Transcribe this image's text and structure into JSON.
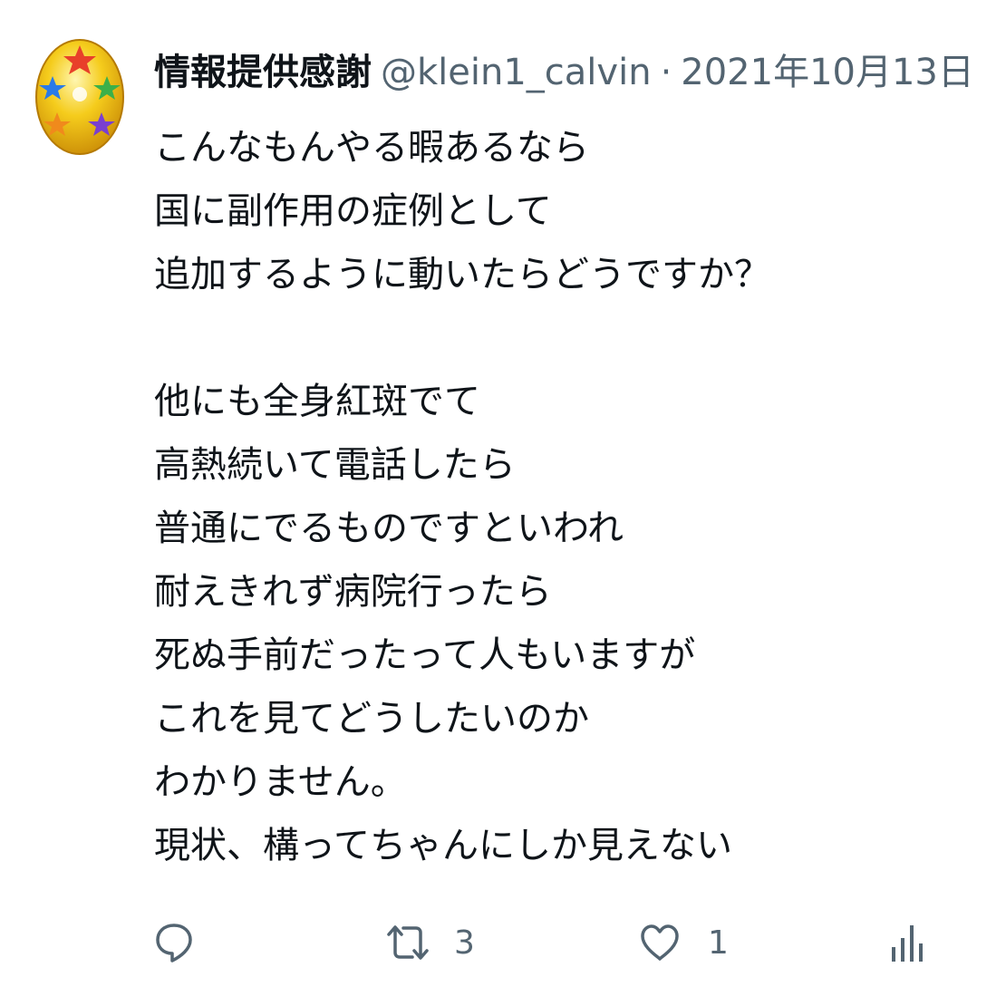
{
  "author": {
    "display_name": "情報提供感謝",
    "handle": "@klein1_calvin",
    "separator": "·",
    "date": "2021年10月13日",
    "avatar_icon": "star-egg-avatar"
  },
  "tweet": {
    "lines": [
      "こんなもんやる暇あるなら",
      "国に副作用の症例として",
      "追加するように動いたらどうですか？",
      "",
      "他にも全身紅斑でて",
      "高熱続いて電話したら",
      "普通にでるものですといわれ",
      "耐えきれず病院行ったら",
      "死ぬ手前だったって人もいますが",
      "これを見てどうしたいのか",
      "わかりません。",
      "現状、構ってちゃんにしか見えない"
    ]
  },
  "actions": {
    "reply": {
      "icon": "reply-icon",
      "count": ""
    },
    "retweet": {
      "icon": "retweet-icon",
      "count": "3"
    },
    "like": {
      "icon": "heart-icon",
      "count": "1"
    },
    "analytics": {
      "icon": "analytics-icon",
      "count": ""
    }
  },
  "colors": {
    "text_primary": "#0f1419",
    "text_secondary": "#536471",
    "background": "#ffffff"
  }
}
